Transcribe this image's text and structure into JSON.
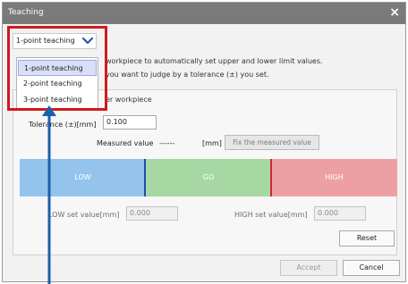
{
  "window": {
    "title": "Teaching"
  },
  "mode_select": {
    "value": "1-point teaching",
    "options": [
      "1-point teaching",
      "2-point teaching",
      "3-point teaching"
    ],
    "selected_index": 0
  },
  "description": {
    "line1": "workpiece to automatically set upper and lower limit values.",
    "line2": "you want to judge by a tolerance (±) you set.",
    "section": "er workpiece"
  },
  "tolerance": {
    "label": "Tolerance (±)[mm]",
    "value": "0.100"
  },
  "measured": {
    "label": "Measured value",
    "value": "------",
    "unit": "[mm]",
    "fix_button": "Fix the measured value"
  },
  "judgement_bar": {
    "low": "LOW",
    "go": "GO",
    "high": "HIGH"
  },
  "low_set": {
    "label": "LOW set value[mm]",
    "value": "0.000"
  },
  "high_set": {
    "label": "HIGH set value[mm]",
    "value": "0.000"
  },
  "buttons": {
    "reset": "Reset",
    "accept": "Accept",
    "cancel": "Cancel"
  },
  "colors": {
    "titlebar": "#7a7a7a",
    "highlight": "#d0191e",
    "arrow": "#1c5fae",
    "low": "#94c4ec",
    "go": "#a7d7a2",
    "high": "#eda0a3",
    "chevron": "#2c57a8"
  },
  "icons": {
    "close": "close-icon",
    "dropdown": "chevron-down-icon",
    "pointer": "up-arrow-annotation"
  }
}
